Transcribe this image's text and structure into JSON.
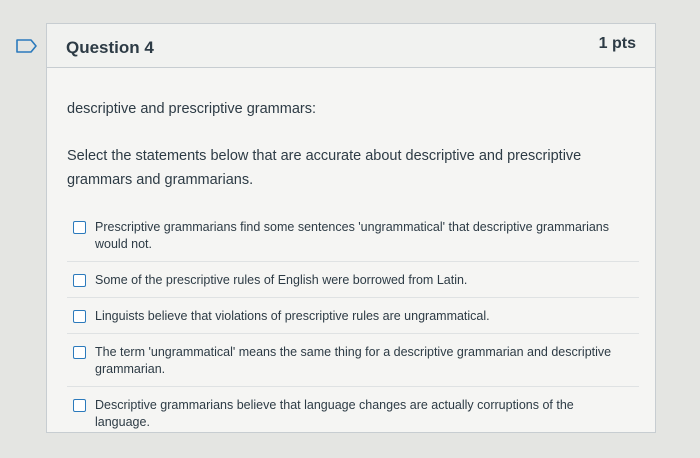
{
  "question": {
    "title": "Question 4",
    "points": "1 pts",
    "prompt": "descriptive and prescriptive grammars:",
    "instructions": "Select the statements below that are accurate about descriptive and prescriptive grammars and grammarians."
  },
  "answers": [
    {
      "label": "Prescriptive grammarians find some sentences 'ungrammatical' that descriptive grammarians would not.",
      "checked": false
    },
    {
      "label": "Some of the prescriptive rules of English were borrowed from Latin.",
      "checked": false
    },
    {
      "label": "Linguists believe that violations of prescriptive rules are ungrammatical.",
      "checked": false
    },
    {
      "label": "The term 'ungrammatical' means the same thing for a descriptive grammarian and descriptive grammarian.",
      "checked": false
    },
    {
      "label": "Descriptive grammarians believe that language changes are actually corruptions of the language.",
      "checked": false
    }
  ],
  "colors": {
    "accent": "#2b7abc",
    "text": "#2d3b45",
    "border": "#c7cdd1"
  },
  "icons": {
    "flag": "bookmark-flag-icon"
  }
}
